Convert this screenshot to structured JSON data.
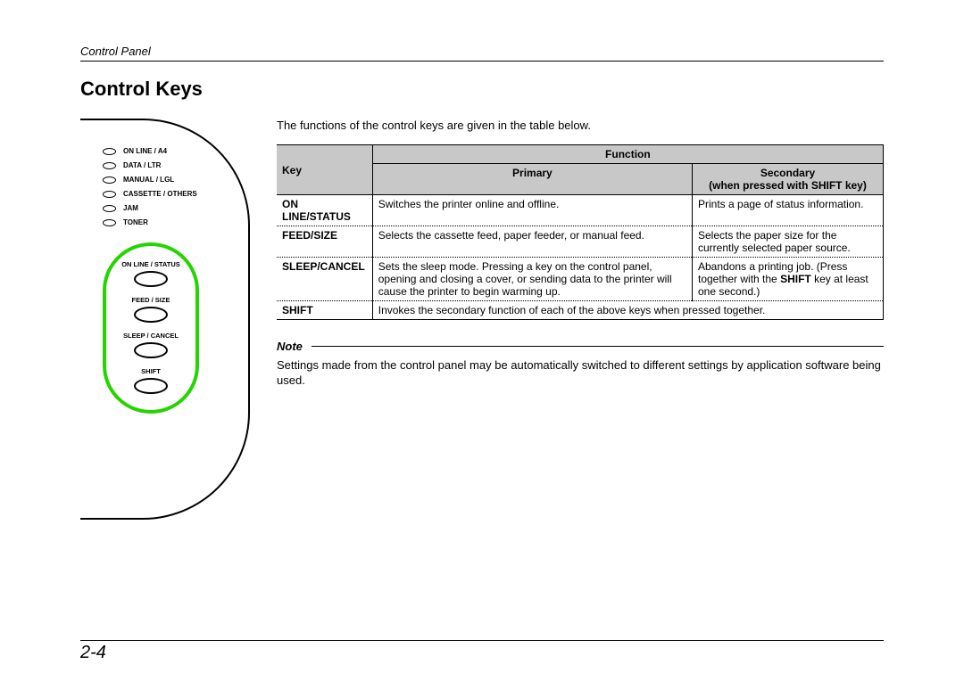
{
  "header": {
    "section": "Control Panel"
  },
  "title": "Control Keys",
  "intro": "The functions of the control keys are given in the table below.",
  "panel": {
    "leds": [
      "ON LINE / A4",
      "DATA / LTR",
      "MANUAL / LGL",
      "CASSETTE / OTHERS",
      "JAM",
      "TONER"
    ],
    "buttons": [
      "ON LINE / STATUS",
      "FEED / SIZE",
      "SLEEP / CANCEL",
      "SHIFT"
    ]
  },
  "table": {
    "head": {
      "key": "Key",
      "function": "Function",
      "primary": "Primary",
      "secondary_line1": "Secondary",
      "secondary_line2_pre": "when pressed with ",
      "secondary_line2_bold": "SHIFT",
      "secondary_line2_post": " key)"
    },
    "rows": [
      {
        "key": "ON LINE/STATUS",
        "primary": "Switches the printer online and offline.",
        "secondary": "Prints a page of status information."
      },
      {
        "key": "FEED/SIZE",
        "primary": "Selects the cassette feed, paper feeder, or manual feed.",
        "secondary": "Selects the paper size for the currently selected paper source."
      },
      {
        "key": "SLEEP/CANCEL",
        "primary": "Sets the sleep mode. Pressing a key on the control panel, opening and closing a cover, or sending data to the printer will cause the printer to begin warming up.",
        "secondary_pre": "Abandons a printing job. (Press together with the ",
        "secondary_bold": "SHIFT",
        "secondary_post": " key at least one second.)"
      },
      {
        "key": "SHIFT",
        "span": "Invokes the secondary function of each of the above keys when pressed together."
      }
    ]
  },
  "note": {
    "label": "Note",
    "body": "Settings made from the control panel may be automatically switched to different settings by application software being used."
  },
  "page_number": "2-4"
}
